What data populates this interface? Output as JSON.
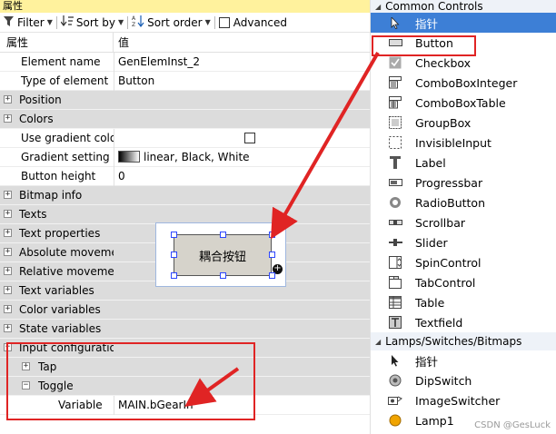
{
  "properties_panel": {
    "title": "属性",
    "toolbar": {
      "filter_label": "Filter",
      "sortby_label": "Sort by",
      "sortorder_label": "Sort order",
      "advanced_label": "Advanced"
    },
    "columns": {
      "property": "属性",
      "value": "值"
    },
    "rows": {
      "element_name": {
        "name": "Element name",
        "value": "GenElemInst_2"
      },
      "type_of_element": {
        "name": "Type of element",
        "value": "Button"
      },
      "position": {
        "name": "Position"
      },
      "colors": {
        "name": "Colors"
      },
      "use_gradient": {
        "name": "Use gradient color"
      },
      "gradient_setting": {
        "name": "Gradient setting",
        "value": "linear, Black, White"
      },
      "button_height": {
        "name": "Button height",
        "value": "0"
      },
      "bitmap_info": {
        "name": "Bitmap info"
      },
      "texts": {
        "name": "Texts"
      },
      "text_properties": {
        "name": "Text properties"
      },
      "absolute_movement": {
        "name": "Absolute movement"
      },
      "relative_movement": {
        "name": "Relative movement"
      },
      "text_variables": {
        "name": "Text variables"
      },
      "color_variables": {
        "name": "Color variables"
      },
      "state_variables": {
        "name": "State variables"
      },
      "input_configuration": {
        "name": "Input configuration"
      },
      "tap": {
        "name": "Tap"
      },
      "toggle": {
        "name": "Toggle"
      },
      "variable": {
        "name": "Variable",
        "value": "MAIN.bGearIn"
      }
    },
    "preview_button_label": "耦合按钮"
  },
  "toolbox": {
    "groups": {
      "common_controls": {
        "label": "Common Controls",
        "items": [
          {
            "label": "指针",
            "icon": "pointer-icon"
          },
          {
            "label": "Button",
            "icon": "button-icon"
          },
          {
            "label": "Checkbox",
            "icon": "checkbox-icon"
          },
          {
            "label": "ComboBoxInteger",
            "icon": "combobox-icon"
          },
          {
            "label": "ComboBoxTable",
            "icon": "combobox-table-icon"
          },
          {
            "label": "GroupBox",
            "icon": "groupbox-icon"
          },
          {
            "label": "InvisibleInput",
            "icon": "invisible-input-icon"
          },
          {
            "label": "Label",
            "icon": "label-icon"
          },
          {
            "label": "Progressbar",
            "icon": "progressbar-icon"
          },
          {
            "label": "RadioButton",
            "icon": "radiobutton-icon"
          },
          {
            "label": "Scrollbar",
            "icon": "scrollbar-icon"
          },
          {
            "label": "Slider",
            "icon": "slider-icon"
          },
          {
            "label": "SpinControl",
            "icon": "spincontrol-icon"
          },
          {
            "label": "TabControl",
            "icon": "tabcontrol-icon"
          },
          {
            "label": "Table",
            "icon": "table-icon"
          },
          {
            "label": "Textfield",
            "icon": "textfield-icon"
          }
        ]
      },
      "lamps": {
        "label": "Lamps/Switches/Bitmaps",
        "items": [
          {
            "label": "指针",
            "icon": "pointer-icon"
          },
          {
            "label": "DipSwitch",
            "icon": "dipswitch-icon"
          },
          {
            "label": "ImageSwitcher",
            "icon": "imageswitcher-icon"
          },
          {
            "label": "Lamp1",
            "icon": "lamp-icon"
          }
        ]
      }
    }
  },
  "watermark": "CSDN @GesLuck",
  "colors": {
    "title_bar": "#fff29d",
    "selected_item": "#3d7fd6",
    "annotation_red": "#e02424",
    "group_row_grey": "#dcdcdc"
  }
}
